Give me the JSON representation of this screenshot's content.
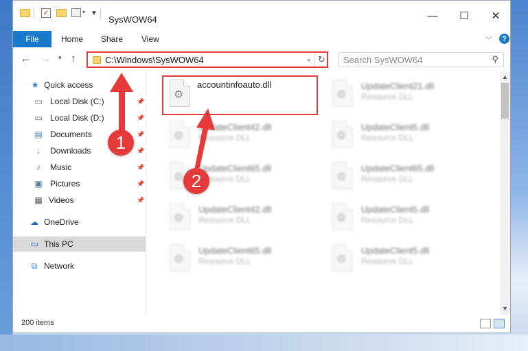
{
  "window": {
    "title": "SysWOW64",
    "controls": {
      "minimize": "—",
      "maximize": "☐",
      "close": "✕"
    }
  },
  "ribbon": {
    "tabs": [
      "File",
      "Home",
      "Share",
      "View"
    ],
    "help": "?"
  },
  "address_bar": {
    "path": "C:\\Windows\\SysWOW64",
    "search_placeholder": "Search SysWOW64"
  },
  "nav": {
    "items": [
      {
        "label": "Quick access",
        "icon": "star-icon",
        "pinned": false
      },
      {
        "label": "Local Disk (C:)",
        "icon": "drive-icon",
        "pinned": true
      },
      {
        "label": "Local Disk (D:)",
        "icon": "drive-icon",
        "pinned": true
      },
      {
        "label": "Documents",
        "icon": "documents-icon",
        "pinned": true
      },
      {
        "label": "Downloads",
        "icon": "download-icon",
        "pinned": true
      },
      {
        "label": "Music",
        "icon": "music-icon",
        "pinned": true
      },
      {
        "label": "Pictures",
        "icon": "pictures-icon",
        "pinned": true
      },
      {
        "label": "Videos",
        "icon": "videos-icon",
        "pinned": true
      },
      {
        "label": "OneDrive",
        "icon": "cloud-icon",
        "pinned": false
      },
      {
        "label": "This PC",
        "icon": "computer-icon",
        "pinned": false,
        "selected": true
      },
      {
        "label": "Network",
        "icon": "network-icon",
        "pinned": false
      }
    ]
  },
  "files": [
    {
      "name": "accountinfoauto.dll",
      "type": "",
      "highlighted": true
    },
    {
      "name": "UpdateClient21.dll",
      "type": "Resource DLL"
    },
    {
      "name": "UpdateClient42.dll",
      "type": "Resource DLL"
    },
    {
      "name": "UpdateClient5.dll",
      "type": "Resource DLL"
    },
    {
      "name": "UpdateClient65.dll",
      "type": "Resource DLL"
    },
    {
      "name": "UpdateClient65.dll",
      "type": "Resource DLL"
    },
    {
      "name": "UpdateClient42.dll",
      "type": "Resource DLL"
    },
    {
      "name": "UpdateClient5.dll",
      "type": "Resource DLL"
    },
    {
      "name": "UpdateClient65.dll",
      "type": "Resource DLL"
    },
    {
      "name": "UpdateClient5.dll",
      "type": "Resource DLL"
    }
  ],
  "status": {
    "item_count": "200 items"
  },
  "annotations": {
    "step1": "1",
    "step2": "2",
    "color": "#e63a3a"
  }
}
